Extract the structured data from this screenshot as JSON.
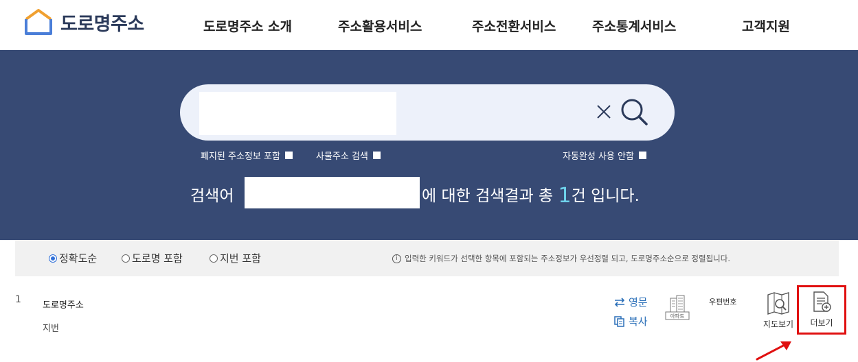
{
  "header": {
    "logo_text": "도로명주소",
    "nav": [
      "도로명주소 소개",
      "주소활용서비스",
      "주소전환서비스",
      "주소통계서비스",
      "고객지원"
    ]
  },
  "search": {
    "input_value": "",
    "options": {
      "abolished": "폐지된 주소정보 포함",
      "object_address": "사물주소 검색",
      "autocomplete_off": "자동완성 사용 안함"
    },
    "result_prefix": "검색어",
    "result_middle": "에 대한 검색결과 총",
    "result_count": "1",
    "result_suffix": "건 입니다."
  },
  "filter": {
    "radios": [
      {
        "label": "정확도순",
        "selected": true
      },
      {
        "label": "도로명 포함",
        "selected": false
      },
      {
        "label": "지번 포함",
        "selected": false
      }
    ],
    "notice": "입력한 키워드가 선택한 항목에 포함되는 주소정보가 우선정렬 되고, 도로명주소순으로 정렬됩니다.",
    "notice_icon": "i"
  },
  "result": {
    "index": "1",
    "road_label": "도로명주소",
    "jibun_label": "지번",
    "english_label": "영문",
    "copy_label": "복사",
    "apt_label": "아파트",
    "zip_label": "우편번호",
    "map_label": "지도보기",
    "more_label": "더보기"
  },
  "colors": {
    "hero_bg": "#374a74",
    "accent": "#2a6fb8",
    "highlight_border": "#e01010",
    "count_color": "#6fd3ec"
  }
}
